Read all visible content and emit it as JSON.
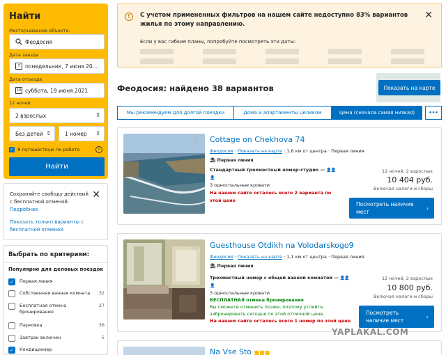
{
  "search": {
    "title": "Найти",
    "place_label": "Место/название объекта:",
    "place_value": "Феодосия",
    "checkin_label": "Дата заезда",
    "checkin_value": "понедельник, 7 июня 20...",
    "checkout_label": "Дата отъезда",
    "checkout_value": "суббота, 19 июня 2021",
    "nights_label": "12 ночей",
    "adults": "2 взрослых",
    "children": "Без детей",
    "rooms": "1 номер",
    "work_trip": "Я путешествую по работе",
    "button": "Найти"
  },
  "promo": {
    "text": "Сохраняйте свободу действий с бесплатной отменой.",
    "more": "Подробнее",
    "link": "Показать только варианты с бесплатной отменой"
  },
  "filters": {
    "title": "Выбрать по критериям:",
    "subtitle": "Популярно для деловых поездок",
    "items": [
      {
        "label": "Первая линия",
        "count": "",
        "checked": true
      },
      {
        "label": "Собственная ванная комната",
        "count": "32",
        "checked": false
      },
      {
        "label": "Бесплатная отмена бронирования",
        "count": "27",
        "checked": false
      },
      {
        "label": "Парковка",
        "count": "36",
        "checked": false
      },
      {
        "label": "Завтрак включен",
        "count": "5",
        "checked": false
      },
      {
        "label": "Кондиционер",
        "count": "",
        "checked": true
      }
    ]
  },
  "alert": {
    "message": "С учетом примененных фильтров на нашем сайте недоступно 83% вариантов жилья по этому направлению.",
    "sub": "Если у вас гибкие планы, попробуйте посмотреть эти даты:"
  },
  "results": {
    "heading": "Феодосия: найдено 38 вариантов",
    "map_button": "Показать на карте",
    "tabs": [
      "Мы рекомендуем для долгой поездки",
      "Дома и апартаменты целиком",
      "Цена (сначала самая низкая)",
      "•••"
    ]
  },
  "cards": [
    {
      "title": "Cottage on Chekhova 74",
      "city": "Феодосия",
      "map_link": "Показать на карте",
      "distance": "1,6 км от центра",
      "line": "Первая линия",
      "first_line": "Первая линия",
      "room_type": "Стандартный трехместный номер-студио —",
      "beds": "3 односпальные кровати",
      "note_red": "На нашем сайте осталось всего 2 варианта по этой цене",
      "nights": "12 ночей, 2 взрослых",
      "price": "10 404 руб.",
      "taxes": "Включая налоги и сборы",
      "button": "Посмотреть наличие мест"
    },
    {
      "title": "Guesthouse Otdikh na Volodarskogo9",
      "city": "Феодосия",
      "map_link": "Показать на карте",
      "distance": "1,1 км от центра",
      "line": "Первая линия",
      "first_line": "Первая линия",
      "room_type": "Трехместный номер с общей ванной комнатой —",
      "beds": "3 односпальные кровати",
      "free_cancel": "БЕСПЛАТНАЯ отмена бронирования",
      "cancel_note": "Вы сможете отменить позже, поэтому успейте забронировать сегодня по этой отличной цене.",
      "note_red": "На нашем сайте осталось всего 1 номер по этой цене",
      "nights": "12 ночей, 2 взрослых",
      "price": "10 800 руб.",
      "taxes": "Включая налоги и сборы",
      "button": "Посмотреть наличие мест"
    },
    {
      "title": "Na Vse Sto"
    }
  ],
  "watermark": "YAPLAKAL.COM"
}
